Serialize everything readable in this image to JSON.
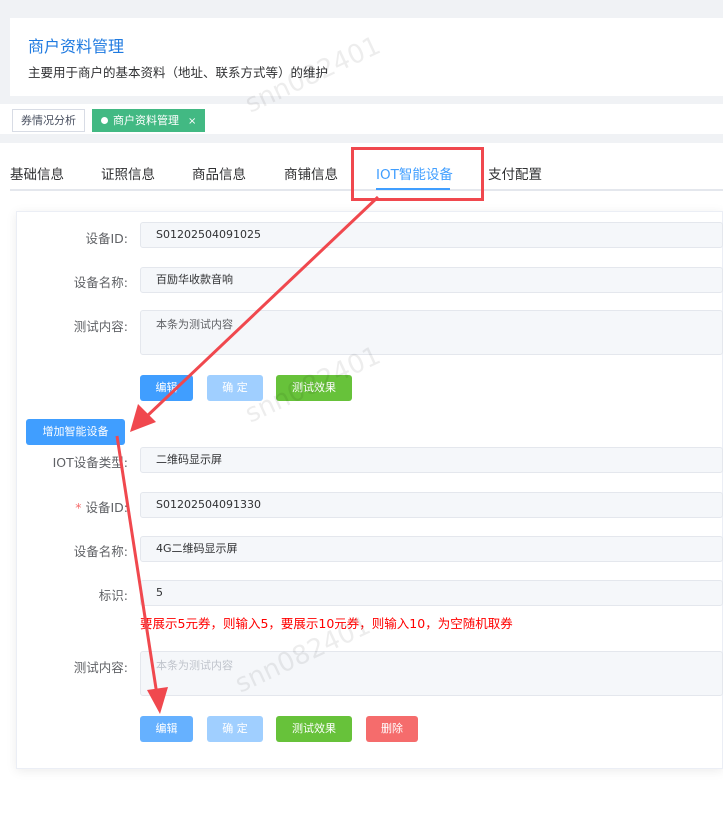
{
  "header": {
    "title": "商户资料管理",
    "description": "主要用于商户的基本资料（地址、联系方式等）的维护"
  },
  "tags": [
    {
      "label": "券情况分析"
    },
    {
      "label": "商户资料管理",
      "close": "×"
    }
  ],
  "tabs": [
    "基础信息",
    "证照信息",
    "商品信息",
    "商铺信息",
    "IOT智能设备",
    "支付配置"
  ],
  "device1": {
    "id_label": "设备ID:",
    "id": "S01202504091025",
    "name_label": "设备名称:",
    "name": "百励华收款音响",
    "test_label": "测试内容:",
    "test": "本条为测试内容"
  },
  "buttons": {
    "edit": "编辑",
    "confirm": "确 定",
    "test": "测试效果",
    "delete": "删除",
    "add": "增加智能设备"
  },
  "device2": {
    "type_label": "IOT设备类型:",
    "type": "二维码显示屏",
    "req": "*",
    "id_label": "设备ID:",
    "id": "S01202504091330",
    "name_label": "设备名称:",
    "name": "4G二维码显示屏",
    "mark_label": "标识:",
    "mark": "5",
    "hint": "要展示5元券，则输入5，要展示10元券，则输入10，为空随机取券",
    "test_label": "测试内容:",
    "test_placeholder": "本条为测试内容"
  },
  "watermark": "snn082401",
  "colors": {
    "primary": "#409eff",
    "tag_active": "#42b983",
    "success": "#67c23a",
    "danger": "#f56c6c",
    "annotation": "#f0484e"
  }
}
